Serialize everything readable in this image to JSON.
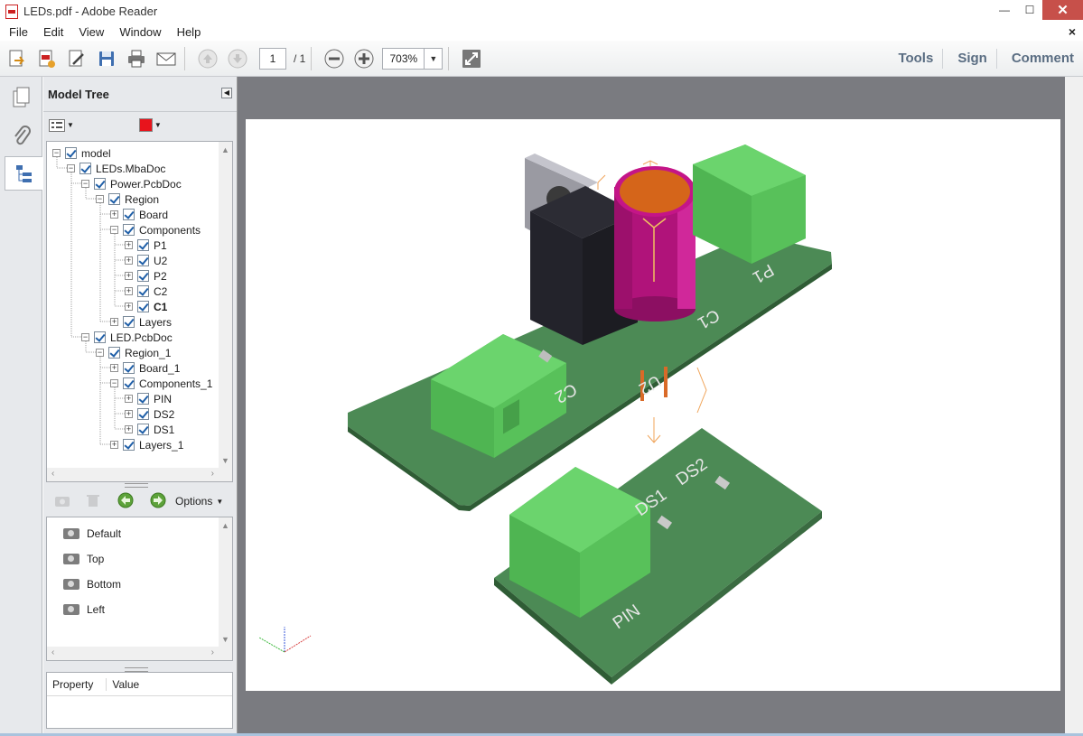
{
  "window": {
    "title": "LEDs.pdf - Adobe Reader",
    "minimize": "—",
    "maximize": "☐",
    "close": "✕"
  },
  "menu": {
    "items": [
      "File",
      "Edit",
      "View",
      "Window",
      "Help"
    ],
    "close_doc": "×"
  },
  "toolbar": {
    "page_current": "1",
    "page_total": "/ 1",
    "zoom": "703%",
    "links": [
      "Tools",
      "Sign",
      "Comment"
    ]
  },
  "panel": {
    "title": "Model Tree",
    "color_swatch": "#e8141c"
  },
  "tree": [
    {
      "label": "model",
      "level": 0,
      "expanded": true
    },
    {
      "label": "LEDs.MbaDoc",
      "level": 1,
      "expanded": true
    },
    {
      "label": "Power.PcbDoc",
      "level": 2,
      "expanded": true
    },
    {
      "label": "Region",
      "level": 3,
      "expanded": true
    },
    {
      "label": "Board",
      "level": 4,
      "expanded": false
    },
    {
      "label": "Components",
      "level": 4,
      "expanded": true
    },
    {
      "label": "P1",
      "level": 5,
      "expanded": false
    },
    {
      "label": "U2",
      "level": 5,
      "expanded": false
    },
    {
      "label": "P2",
      "level": 5,
      "expanded": false
    },
    {
      "label": "C2",
      "level": 5,
      "expanded": false
    },
    {
      "label": "C1",
      "level": 5,
      "expanded": false,
      "selected": true
    },
    {
      "label": "Layers",
      "level": 4,
      "expanded": false
    },
    {
      "label": "LED.PcbDoc",
      "level": 2,
      "expanded": true
    },
    {
      "label": "Region_1",
      "level": 3,
      "expanded": true
    },
    {
      "label": "Board_1",
      "level": 4,
      "expanded": false
    },
    {
      "label": "Components_1",
      "level": 4,
      "expanded": true
    },
    {
      "label": "PIN",
      "level": 5,
      "expanded": false
    },
    {
      "label": "DS2",
      "level": 5,
      "expanded": false
    },
    {
      "label": "DS1",
      "level": 5,
      "expanded": false
    },
    {
      "label": "Layers_1",
      "level": 4,
      "expanded": false
    }
  ],
  "views": {
    "options_label": "Options",
    "items": [
      "Default",
      "Top",
      "Bottom",
      "Left"
    ]
  },
  "properties": {
    "col_property": "Property",
    "col_value": "Value"
  },
  "model3d": {
    "silk_labels": [
      "P1",
      "C1",
      "U2",
      "C2",
      "DS1",
      "DS2",
      "PIN"
    ],
    "colors": {
      "board": "#3f7a47",
      "connector": "#5cc65d",
      "capacitor": "#b0137a",
      "cap_top": "#d5651a",
      "regulator": "#1f1f26",
      "heatsink": "#9a9aa2",
      "background": "#7a7b80"
    }
  }
}
